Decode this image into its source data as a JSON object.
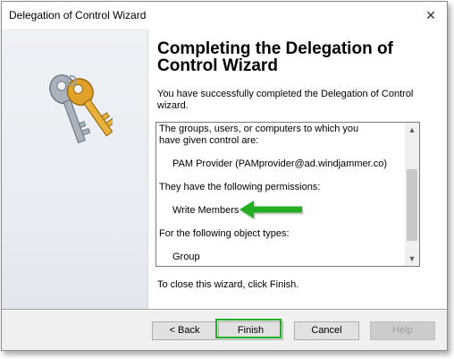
{
  "window": {
    "title": "Delegation of Control Wizard",
    "close_symbol": "✕"
  },
  "main": {
    "heading": "Completing the Delegation of Control Wizard",
    "intro": "You have successfully completed the Delegation of Control wizard.",
    "summary_lines": [
      "The groups, users, or computers to which you",
      "have given control are:",
      "PAM Provider (PAMprovider@ad.windjammer.co)",
      "They have the following permissions:",
      "Write Members",
      "For the following object types:",
      "Group"
    ],
    "close_note": "To close this wizard, click Finish."
  },
  "scrollbar": {
    "up_symbol": "▲",
    "down_symbol": "▼"
  },
  "buttons": {
    "back": "< Back",
    "finish": "Finish",
    "cancel": "Cancel",
    "help": "Help"
  },
  "icons": {
    "wizard_icon": "keys-icon",
    "annotation": "green-arrow-icon"
  },
  "colors": {
    "highlight": "#22b022",
    "arrow": "#22b022",
    "key_gold": "#e2a22a",
    "key_silver": "#a9b2bd"
  }
}
